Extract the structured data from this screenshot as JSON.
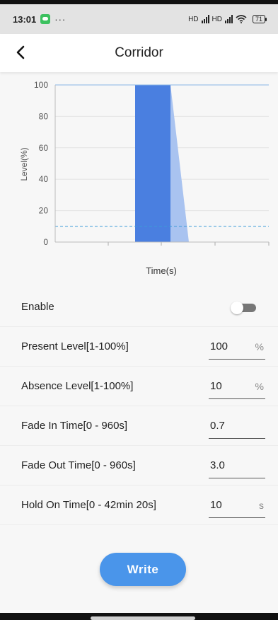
{
  "status_bar": {
    "time": "13:01",
    "more": "···",
    "network1": "HD",
    "network2": "HD",
    "battery": "71"
  },
  "header": {
    "back_icon": "chevron-left-icon",
    "title": "Corridor"
  },
  "chart_data": {
    "type": "area",
    "xlabel": "Time(s)",
    "ylabel": "Level(%)",
    "ylim": [
      0,
      100
    ],
    "yticks": [
      "0",
      "20",
      "40",
      "60",
      "80",
      "100"
    ],
    "grid": true,
    "present_level": 100,
    "absence_level": 10,
    "colors": {
      "hold": "#4a7fe0",
      "fade": "#a9c3f0",
      "absence_line": "#3c9bd8",
      "top_line": "#8ab6e6"
    }
  },
  "settings": {
    "enable": {
      "label": "Enable",
      "on": false
    },
    "present_level": {
      "label": "Present Level[1-100%]",
      "value": "100",
      "unit": "%"
    },
    "absence_level": {
      "label": "Absence Level[1-100%]",
      "value": "10",
      "unit": "%"
    },
    "fade_in": {
      "label": "Fade In Time[0 - 960s]",
      "value": "0.7",
      "unit": ""
    },
    "fade_out": {
      "label": "Fade Out Time[0 - 960s]",
      "value": "3.0",
      "unit": ""
    },
    "hold_on": {
      "label": "Hold On Time[0 - 42min 20s]",
      "value": "10",
      "unit": "s"
    }
  },
  "actions": {
    "write_label": "Write"
  },
  "colors": {
    "accent": "#4a95ea",
    "toggle_off": "#777777"
  }
}
